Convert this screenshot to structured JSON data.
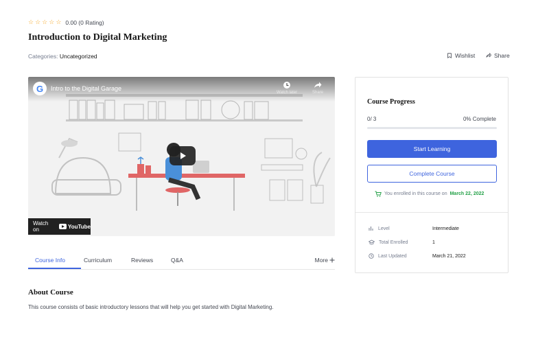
{
  "rating": {
    "stars": [
      "☆",
      "☆",
      "☆",
      "☆",
      "☆"
    ],
    "text": "0.00 (0 Rating)"
  },
  "course": {
    "title": "Introduction to Digital Marketing",
    "categories_label": "Categories:",
    "categories_value": "Uncategorized"
  },
  "actions": {
    "wishlist": "Wishlist",
    "share": "Share"
  },
  "video": {
    "title": "Intro to the Digital Garage",
    "watch_later": "Watch later",
    "share": "Share",
    "watch_on": "Watch on",
    "youtube": "YouTube"
  },
  "tabs": {
    "items": [
      "Course Info",
      "Curriculum",
      "Reviews",
      "Q&A"
    ],
    "more": "More"
  },
  "about": {
    "heading": "About Course",
    "text": "This course consists of basic introductory lessons that will help you get started with Digital Marketing."
  },
  "progress": {
    "heading": "Course Progress",
    "count": "0/ 3",
    "percent_text": "0% Complete",
    "fraction": 0
  },
  "buttons": {
    "start": "Start Learning",
    "complete": "Complete Course"
  },
  "enrollment": {
    "text": "You enrolled in this course on",
    "date": "March 22, 2022"
  },
  "meta": {
    "level_label": "Level",
    "level_value": "Intermediate",
    "enrolled_label": "Total Enrolled",
    "enrolled_value": "1",
    "updated_label": "Last Updated",
    "updated_value": "March 21, 2022"
  },
  "colors": {
    "accent": "#3e64de",
    "success": "#24a148",
    "star": "#f5a623"
  }
}
